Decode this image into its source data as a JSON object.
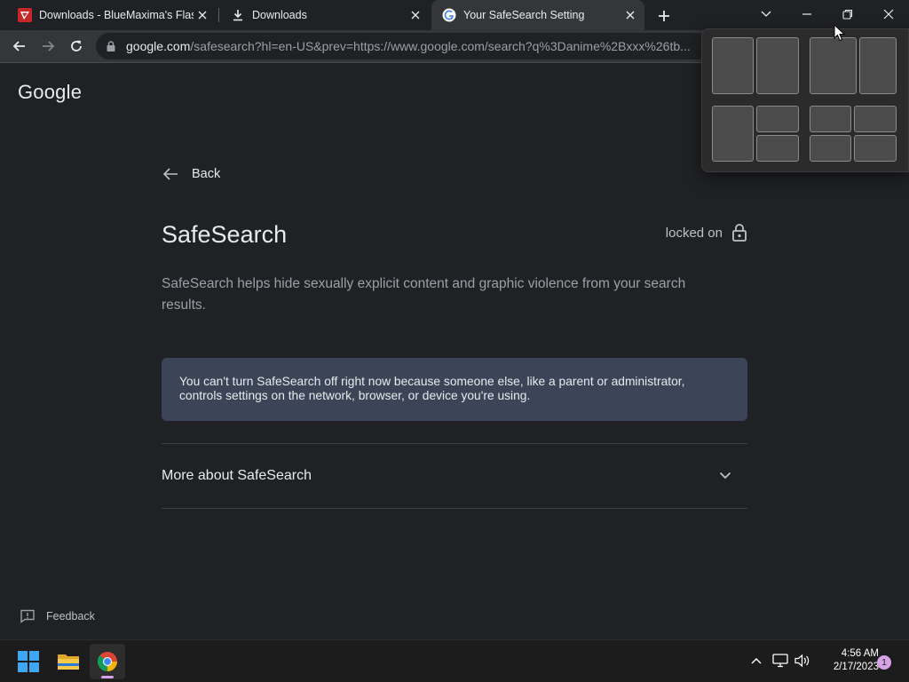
{
  "browser": {
    "tabs": [
      {
        "title": "Downloads - BlueMaxima's Flashpoint",
        "icon": "flashpoint-icon",
        "active": false
      },
      {
        "title": "Downloads",
        "icon": "download-icon",
        "active": false
      },
      {
        "title": "Your SafeSearch Setting",
        "icon": "google-g-icon",
        "active": true
      }
    ],
    "url_host": "google.com",
    "url_path": "/safesearch?hl=en-US&prev=https://www.google.com/search?q%3Danime%2Bxxx%26tb..."
  },
  "page": {
    "logo_text": "Google",
    "back_label": "Back",
    "title": "SafeSearch",
    "status": "locked on",
    "description": "SafeSearch helps hide sexually explicit content and graphic violence from your search results.",
    "notice": "You can't turn SafeSearch off right now because someone else, like a parent or administrator, controls settings on the network, browser, or device you're using.",
    "more_label": "More about SafeSearch",
    "feedback_label": "Feedback"
  },
  "taskbar": {
    "apps": [
      "windows-start-icon",
      "file-explorer-icon",
      "chrome-icon"
    ],
    "time": "4:56 AM",
    "date": "2/17/2023",
    "notification_count": "1"
  },
  "colors": {
    "page_bg": "#202124",
    "toolbar_bg": "#35363a",
    "notice_bg": "#3c4557",
    "taskbar_bg": "#1c1c1c"
  }
}
